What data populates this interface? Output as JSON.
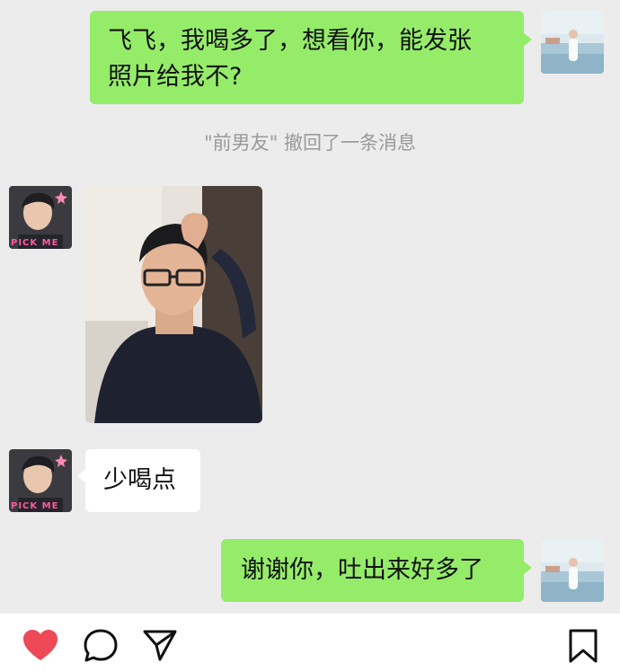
{
  "messages": [
    {
      "side": "out",
      "text_line1": "飞飞，我喝多了，想看你，能发张",
      "text_line2": "照片给我不?"
    },
    {
      "type": "system",
      "text": "\"前男友\" 撤回了一条消息"
    },
    {
      "side": "in",
      "type": "image"
    },
    {
      "side": "in",
      "text": "少喝点"
    },
    {
      "side": "out",
      "text": "谢谢你，吐出来好多了"
    }
  ],
  "avatar_badge": "PICK ME",
  "colors": {
    "out_bubble": "#95ec69",
    "in_bubble": "#ffffff",
    "chat_bg": "#ececec",
    "like": "#ed4956"
  },
  "actions": {
    "icons": [
      "heart-icon",
      "comment-icon",
      "share-icon",
      "bookmark-icon"
    ]
  }
}
